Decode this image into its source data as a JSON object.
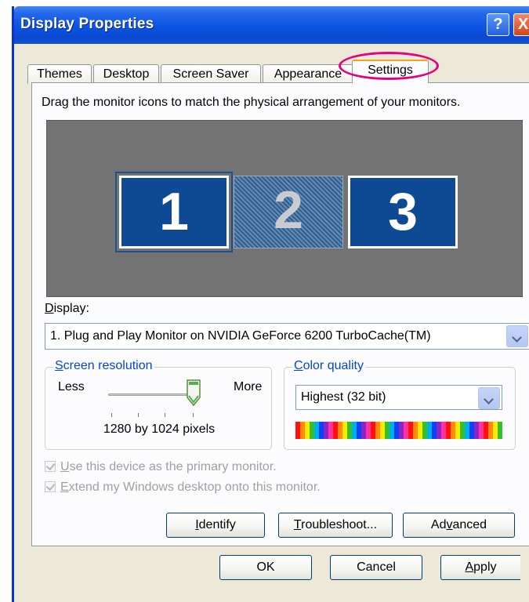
{
  "window": {
    "title": "Display Properties",
    "help_glyph": "?",
    "close_glyph": "X"
  },
  "tabs": [
    {
      "label": "Themes"
    },
    {
      "label": "Desktop"
    },
    {
      "label": "Screen Saver"
    },
    {
      "label": "Appearance"
    },
    {
      "label": "Settings",
      "active": true
    }
  ],
  "settings": {
    "instruction": "Drag the monitor icons to match the physical arrangement of your monitors.",
    "monitors": [
      {
        "number": "1",
        "selected": true
      },
      {
        "number": "2",
        "selected": false
      },
      {
        "number": "3",
        "selected": false
      }
    ],
    "display_label_prefix": "D",
    "display_label_rest": "isplay:",
    "display_value": "1. Plug and Play Monitor on NVIDIA GeForce 6200 TurboCache(TM)",
    "resolution": {
      "legend_prefix": "S",
      "legend_rest": "creen resolution",
      "less": "Less",
      "more": "More",
      "value_text": "1280 by 1024 pixels",
      "slider_level": 1.0
    },
    "color_quality": {
      "legend_prefix": "C",
      "legend_rest": "olor quality",
      "value": "Highest (32 bit)"
    },
    "checks": {
      "primary_prefix": "U",
      "primary_rest": "se this device as the primary monitor.",
      "extend_prefix": "E",
      "extend_rest": "xtend my Windows desktop onto this monitor."
    },
    "buttons": {
      "identify_prefix": "I",
      "identify_rest": "dentify",
      "troubleshoot_prefix": "T",
      "troubleshoot_rest": "roubleshoot...",
      "advanced_pre": "Ad",
      "advanced_u": "v",
      "advanced_rest": "anced"
    }
  },
  "footer": {
    "ok": "OK",
    "cancel": "Cancel",
    "apply_prefix": "A",
    "apply_rest": "pply"
  },
  "colors": {
    "titlebar": "#0a54e3",
    "monitor": "#0e4a94",
    "highlight": "#e6007e",
    "legend": "#0046d5"
  }
}
